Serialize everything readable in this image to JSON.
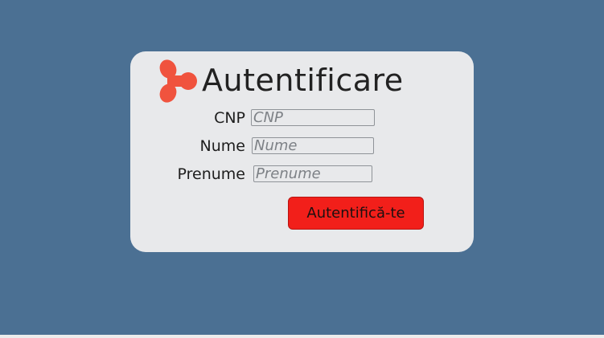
{
  "login": {
    "title": "Autentificare",
    "fields": {
      "cnp": {
        "label": "CNP",
        "value": "",
        "placeholder": "CNP"
      },
      "nume": {
        "label": "Nume",
        "value": "",
        "placeholder": "Nume"
      },
      "prenume": {
        "label": "Prenume",
        "value": "",
        "placeholder": "Prenume"
      }
    },
    "submit_label": "Autentifică-te"
  },
  "icons": {
    "logo": "brand-logo-icon"
  },
  "colors": {
    "page_background": "#4b7093",
    "card_background": "#e8e9eb",
    "logo_accent": "#f0533e",
    "button_background": "#f21f1a",
    "text": "#222222"
  }
}
